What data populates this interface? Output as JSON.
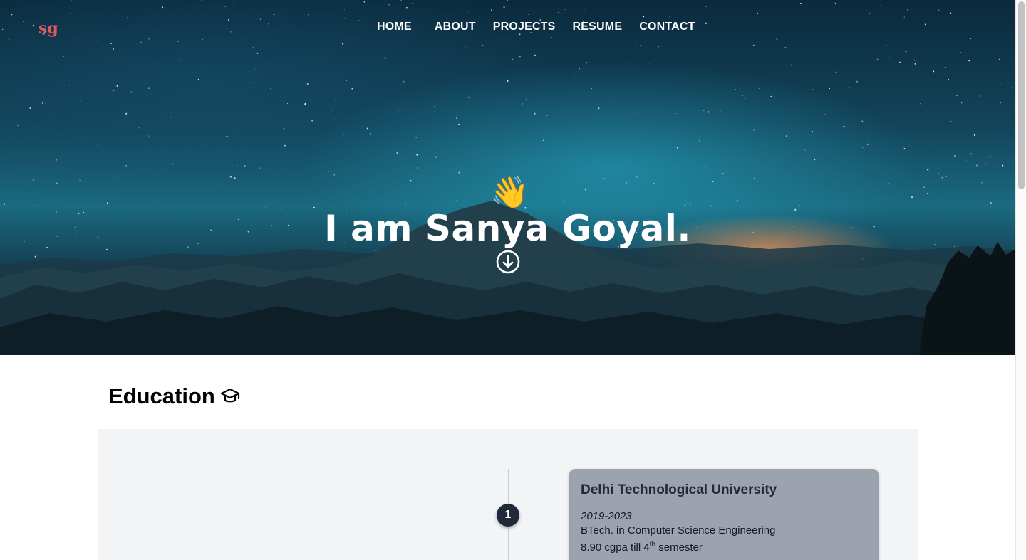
{
  "brand": {
    "logo": "sg",
    "logo_color": "#e2585a"
  },
  "nav": {
    "items": [
      {
        "label": "HOME"
      },
      {
        "label": "ABOUT"
      },
      {
        "label": "PROJECTS"
      },
      {
        "label": "RESUME"
      },
      {
        "label": "CONTACT"
      }
    ]
  },
  "hero": {
    "wave": "👋",
    "title": "I am Sanya Goyal.",
    "down_icon": "arrow-down-circle-icon"
  },
  "education": {
    "title": "Education",
    "title_icon": "graduation-cap-icon",
    "items": [
      {
        "marker": "1",
        "name": "Delhi Technological University",
        "years": "2019-2023",
        "degree": "BTech. in Computer Science Engineering",
        "gpa_prefix": "8.90 cgpa till 4",
        "gpa_sup": "th",
        "gpa_suffix": " semester"
      }
    ]
  },
  "colors": {
    "timeline_panel": "#f3f4f6",
    "card": "#9ca3af",
    "marker": "#1f2937"
  }
}
